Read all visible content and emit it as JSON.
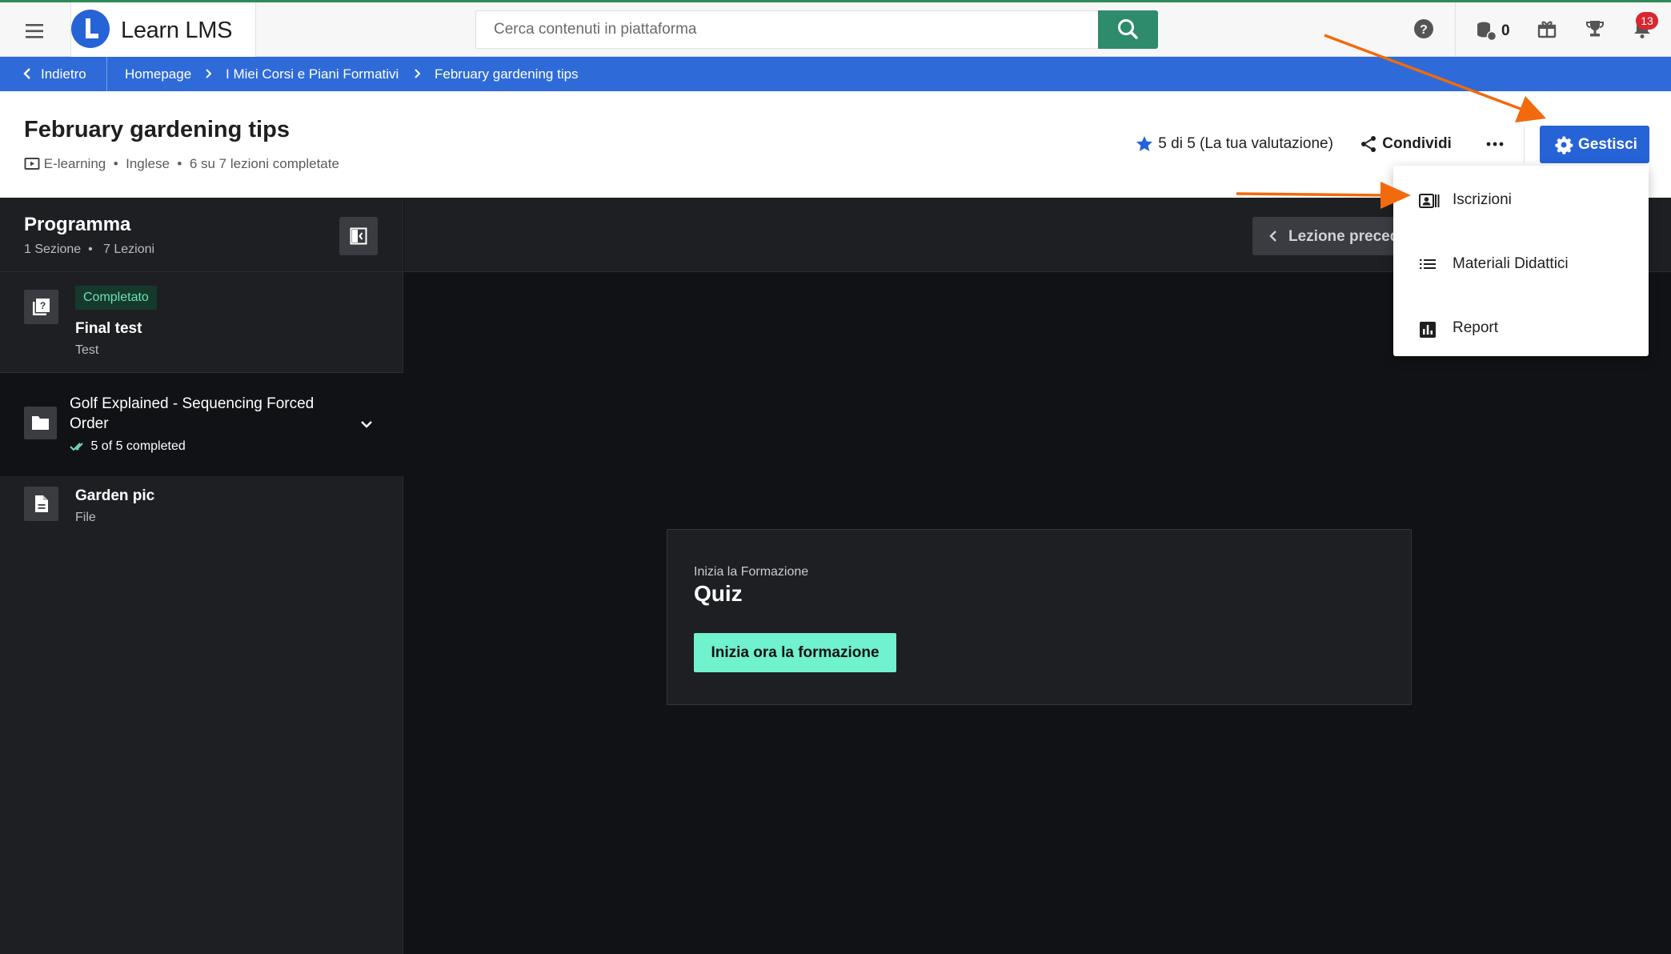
{
  "app": {
    "name": "Learn LMS"
  },
  "search": {
    "placeholder": "Cerca contenuti in piattaforma"
  },
  "topbar": {
    "coins": "0",
    "notifications_count": "13",
    "icons": [
      "menu-icon",
      "search-icon",
      "help-icon",
      "coins-icon",
      "gift-icon",
      "trophy-icon",
      "bell-icon"
    ]
  },
  "breadcrumb": {
    "back_label": "Indietro",
    "items": [
      "Homepage",
      "I Miei Corsi e Piani Formativi",
      "February gardening tips"
    ]
  },
  "course": {
    "title": "February gardening tips",
    "meta": {
      "type": "E-learning",
      "language": "Inglese",
      "progress": "6 su 7 lezioni completate"
    },
    "rating_text": "5 di 5 (La tua valutazione)",
    "share_label": "Condividi",
    "manage_label": "Gestisci"
  },
  "manage_menu": {
    "items": [
      {
        "label": "Iscrizioni",
        "icon": "enrollments-icon"
      },
      {
        "label": "Materiali Didattici",
        "icon": "list-icon"
      },
      {
        "label": "Report",
        "icon": "report-icon"
      }
    ]
  },
  "sidebar": {
    "title": "Programma",
    "sections_count": "1 Sezione",
    "lessons_count": "7 Lezioni",
    "items": [
      {
        "status": "Completato",
        "title": "Final test",
        "subtitle": "Test",
        "icon": "quiz-icon"
      },
      {
        "title": "Golf Explained - Sequencing Forced Order",
        "progress": "5 of 5 completed",
        "icon": "folder-icon"
      },
      {
        "title": "Garden pic",
        "subtitle": "File",
        "icon": "file-icon"
      }
    ]
  },
  "main": {
    "prev_label": "Lezione precedente",
    "card": {
      "eyebrow": "Inizia la Formazione",
      "title": "Quiz",
      "cta": "Inizia ora la formazione"
    }
  },
  "colors": {
    "brand_blue": "#2563d6",
    "breadcrumb_blue": "#2e6bd8",
    "search_green": "#2e8b6c",
    "cta_mint": "#6ff2cd",
    "annotation_orange": "#f26a0c",
    "badge_red": "#d9262f"
  }
}
